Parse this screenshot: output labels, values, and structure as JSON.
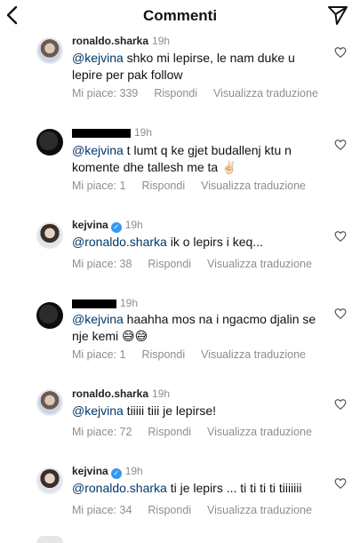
{
  "header": {
    "title": "Commenti",
    "back_icon": "chevron-left-icon",
    "share_icon": "paper-plane-icon"
  },
  "actions_labels": {
    "reply": "Rispondi",
    "translate": "Visualizza traduzione"
  },
  "comments": [
    {
      "user": "ronaldo.sharka",
      "time": "19h",
      "mention": "@kejvina",
      "text": " shko mi lepirse, le nam duke u lepire per pak follow",
      "likes": "Mi piace: 339"
    },
    {
      "user": "",
      "time": "19h",
      "mention": "@kejvina",
      "text": " t lumt q ke  gjet budallenj ktu n komente dhe tallesh me ta ✌🏻",
      "likes": "Mi piace: 1"
    },
    {
      "user": "kejvina",
      "time": "19h",
      "mention": "@ronaldo.sharka",
      "text": " ik o lepirs i keq...",
      "likes": "Mi piace: 38"
    },
    {
      "user": "",
      "time": "19h",
      "mention": "@kejvina",
      "text": "  haahha mos na i ngacmo djalin se nje kemi 😅😅",
      "likes": "Mi piace: 1"
    },
    {
      "user": "ronaldo.sharka",
      "time": "19h",
      "mention": "@kejvina",
      "text": " tiiiii tiii je lepirse!",
      "likes": "Mi piace: 72"
    },
    {
      "user": "kejvina",
      "time": "19h",
      "mention": "@ronaldo.sharka",
      "text": " ti je lepirs ... ti ti ti ti tiiiiiii",
      "likes": "Mi piace: 34"
    }
  ]
}
